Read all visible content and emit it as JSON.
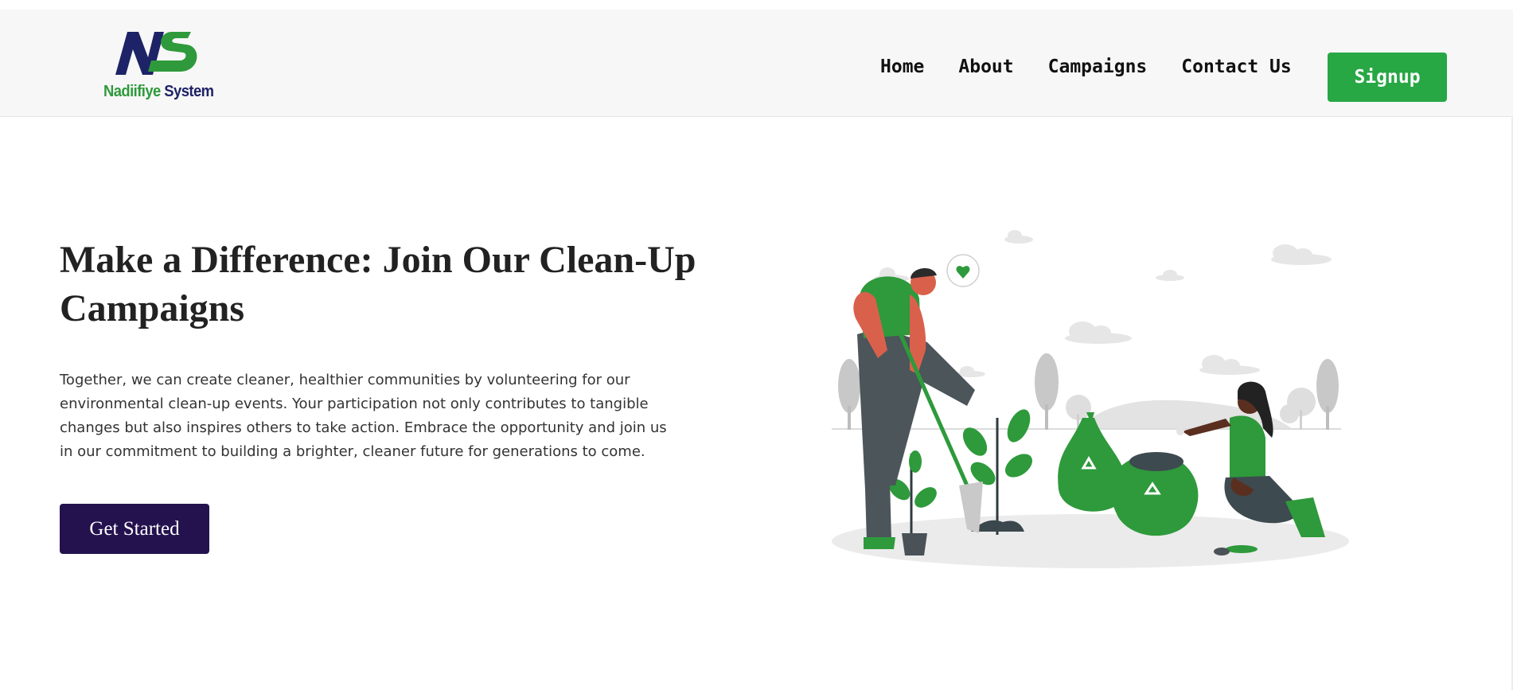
{
  "header": {
    "logo": {
      "mark": "NS",
      "word1": "Nadiifiye",
      "word2": "System"
    },
    "nav": [
      {
        "label": "Home"
      },
      {
        "label": "About"
      },
      {
        "label": "Campaigns"
      },
      {
        "label": "Contact Us"
      }
    ],
    "signup_label": "Signup"
  },
  "hero": {
    "title": "Make a Difference: Join Our Clean-Up Campaigns",
    "description": "Together, we can create cleaner, healthier communities by volunteering for our environmental clean-up events. Your participation not only contributes to tangible changes but also inspires others to take action. Embrace the opportunity and join us in our commitment to building a brighter, cleaner future for generations to come.",
    "cta_label": "Get Started"
  },
  "colors": {
    "brand_green": "#28a745",
    "brand_navy": "#1d2366",
    "cta_bg": "#24124f",
    "nav_bg": "#f7f7f7"
  }
}
